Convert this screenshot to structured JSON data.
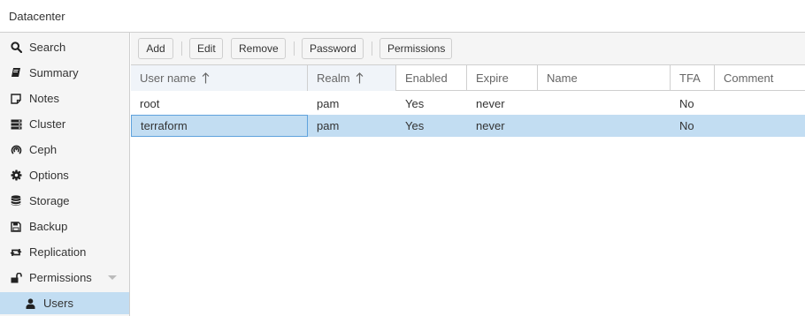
{
  "header": {
    "title": "Datacenter"
  },
  "sidebar": {
    "items": [
      {
        "label": "Search",
        "icon": "search-icon"
      },
      {
        "label": "Summary",
        "icon": "book-icon"
      },
      {
        "label": "Notes",
        "icon": "sticky-note-icon"
      },
      {
        "label": "Cluster",
        "icon": "server-icon"
      },
      {
        "label": "Ceph",
        "icon": "ceph-icon"
      },
      {
        "label": "Options",
        "icon": "gear-icon"
      },
      {
        "label": "Storage",
        "icon": "database-icon"
      },
      {
        "label": "Backup",
        "icon": "floppy-icon"
      },
      {
        "label": "Replication",
        "icon": "retweet-icon"
      },
      {
        "label": "Permissions",
        "icon": "unlock-icon"
      },
      {
        "label": "Users",
        "icon": "user-icon"
      }
    ],
    "selected": "Users"
  },
  "toolbar": {
    "add_label": "Add",
    "edit_label": "Edit",
    "remove_label": "Remove",
    "password_label": "Password",
    "permissions_label": "Permissions"
  },
  "grid": {
    "columns": [
      "User name",
      "Realm",
      "Enabled",
      "Expire",
      "Name",
      "TFA",
      "Comment"
    ],
    "sorted_columns": [
      "User name",
      "Realm"
    ],
    "rows": [
      {
        "username": "root",
        "realm": "pam",
        "enabled": "Yes",
        "expire": "never",
        "name": "",
        "tfa": "No",
        "comment": ""
      },
      {
        "username": "terraform",
        "realm": "pam",
        "enabled": "Yes",
        "expire": "never",
        "name": "",
        "tfa": "No",
        "comment": ""
      }
    ],
    "selected_row": 1
  },
  "colors": {
    "selection": "#c2ddf2",
    "focus_border": "#5fa2dd",
    "border": "#cfcfcf",
    "panel_bg": "#f5f5f5"
  }
}
